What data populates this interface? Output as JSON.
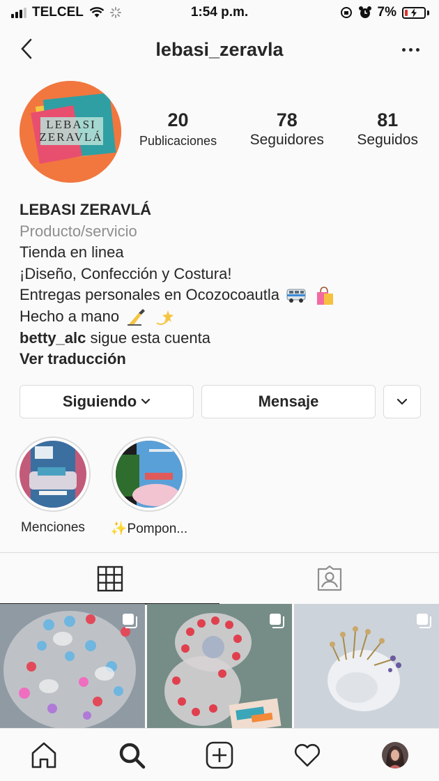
{
  "status_bar": {
    "carrier": "TELCEL",
    "time": "1:54 p.m.",
    "battery": "7%"
  },
  "header": {
    "username": "lebasi_zeravla"
  },
  "profile": {
    "avatar_text_line1": "LEBASI",
    "avatar_text_line2": "ZERAVLÁ",
    "stats": [
      {
        "value": "20",
        "label": "Publicaciones"
      },
      {
        "value": "78",
        "label": "Seguidores"
      },
      {
        "value": "81",
        "label": "Seguidos"
      }
    ],
    "name": "LEBASI ZERAVLÁ",
    "category": "Producto/servicio",
    "bio_lines": [
      "Tienda en linea",
      "¡Diseño, Confección y Costura!",
      "Entregas personales en Ocozocoautla",
      "Hecho a mano"
    ],
    "followed_by_user": "betty_alc",
    "followed_by_text": "sigue esta cuenta",
    "translate_label": "Ver traducción"
  },
  "actions": {
    "following_label": "Siguiendo",
    "message_label": "Mensaje"
  },
  "highlights": [
    {
      "label": "Menciones"
    },
    {
      "label": "✨Pompon..."
    }
  ],
  "tabs": [
    {
      "icon": "grid-icon",
      "active": true
    },
    {
      "icon": "tagged-icon",
      "active": false
    }
  ],
  "bottom_nav": [
    "home-icon",
    "search-icon",
    "new-post-icon",
    "activity-heart-icon",
    "profile-avatar"
  ],
  "colors": {
    "avatar_bg": "#f1773f",
    "battery_low": "#e0302a"
  }
}
